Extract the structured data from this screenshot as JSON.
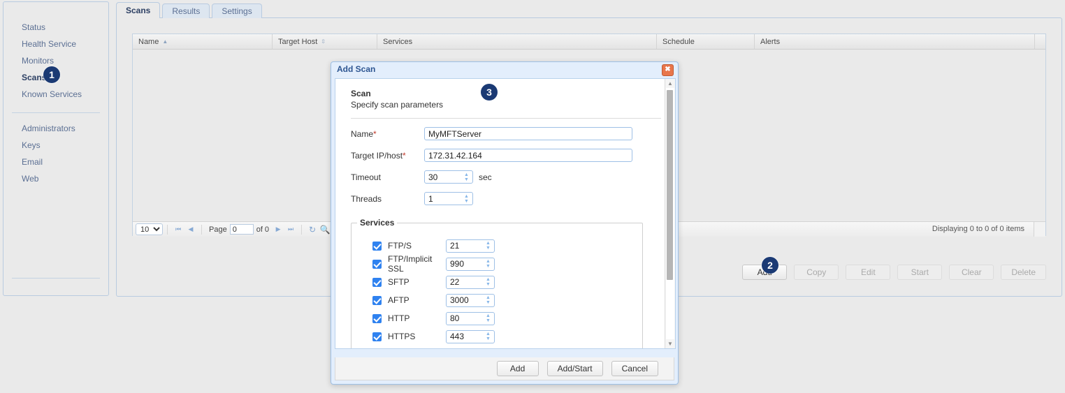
{
  "sidebar": {
    "group1": [
      {
        "label": "Status",
        "active": false
      },
      {
        "label": "Health Service",
        "active": false
      },
      {
        "label": "Monitors",
        "active": false
      },
      {
        "label": "Scans",
        "active": true
      },
      {
        "label": "Known Services",
        "active": false
      }
    ],
    "group2": [
      {
        "label": "Administrators"
      },
      {
        "label": "Keys"
      },
      {
        "label": "Email"
      },
      {
        "label": "Web"
      }
    ]
  },
  "badges": {
    "one": "1",
    "two": "2",
    "three": "3",
    "color": "#1b3a74"
  },
  "tabs": [
    {
      "label": "Scans",
      "active": true
    },
    {
      "label": "Results",
      "active": false
    },
    {
      "label": "Settings",
      "active": false
    }
  ],
  "grid": {
    "columns": [
      {
        "label": "Name",
        "sort": "asc"
      },
      {
        "label": "Target Host",
        "sort": "both"
      },
      {
        "label": "Services",
        "sort": "none"
      },
      {
        "label": "Schedule",
        "sort": "none"
      },
      {
        "label": "Alerts",
        "sort": "none"
      }
    ],
    "rows": [],
    "pager": {
      "page_size": "10",
      "page_label": "Page",
      "page_value": "0",
      "of_label": "of 0",
      "first_icon": "first-page-icon",
      "prev_icon": "previous-page-icon",
      "next_icon": "next-page-icon",
      "last_icon": "last-page-icon",
      "refresh_icon": "refresh-icon",
      "search_icon": "search-icon"
    },
    "status": "Displaying 0 to 0 of 0 items"
  },
  "actions": [
    {
      "label": "Add",
      "disabled": false
    },
    {
      "label": "Copy",
      "disabled": true
    },
    {
      "label": "Edit",
      "disabled": true
    },
    {
      "label": "Start",
      "disabled": true
    },
    {
      "label": "Clear",
      "disabled": true
    },
    {
      "label": "Delete",
      "disabled": true
    }
  ],
  "dialog": {
    "title": "Add Scan",
    "close_icon": "close-icon",
    "section_title": "Scan",
    "section_subtitle": "Specify scan parameters",
    "fields": {
      "name_label": "Name",
      "name_value": "MyMFTServer",
      "target_label": "Target IP/host",
      "target_value": "172.31.42.164",
      "timeout_label": "Timeout",
      "timeout_value": "30",
      "timeout_unit": "sec",
      "threads_label": "Threads",
      "threads_value": "1",
      "required_marker": "*"
    },
    "services_legend": "Services",
    "services": [
      {
        "label": "FTP/S",
        "checked": true,
        "port": "21"
      },
      {
        "label": "FTP/Implicit SSL",
        "checked": true,
        "port": "990"
      },
      {
        "label": "SFTP",
        "checked": true,
        "port": "22"
      },
      {
        "label": "AFTP",
        "checked": true,
        "port": "3000"
      },
      {
        "label": "HTTP",
        "checked": true,
        "port": "80"
      },
      {
        "label": "HTTPS",
        "checked": true,
        "port": "443"
      }
    ],
    "buttons": [
      {
        "label": "Add"
      },
      {
        "label": "Add/Start"
      },
      {
        "label": "Cancel"
      }
    ]
  }
}
